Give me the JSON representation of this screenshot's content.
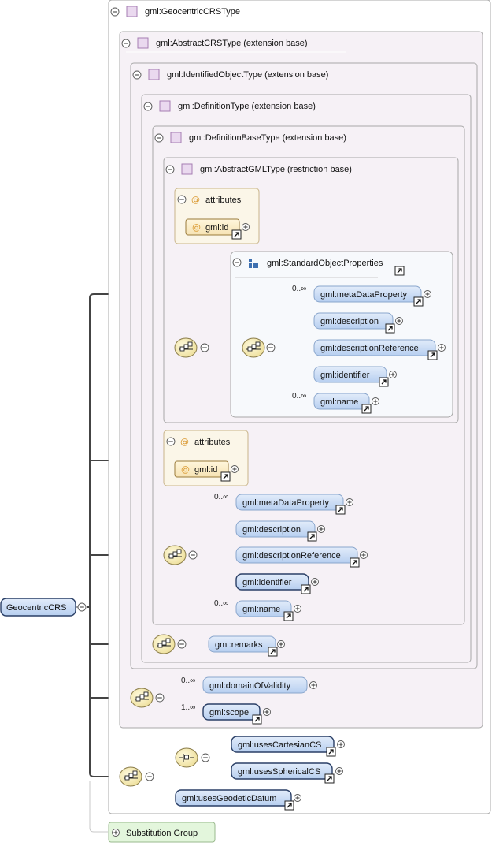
{
  "root": {
    "name": "GeocentricCRS"
  },
  "types": {
    "geocentric": "gml:GeocentricCRSType",
    "abstract_crs": "gml:AbstractCRSType (extension base)",
    "identified_object": "gml:IdentifiedObjectType (extension base)",
    "definition": "gml:DefinitionType (extension base)",
    "definition_base": "gml:DefinitionBaseType (extension base)",
    "abstract_gml": "gml:AbstractGMLType (restriction base)"
  },
  "abstract_gml": {
    "attributes_label": "attributes",
    "attr_id": "gml:id",
    "group_name": "gml:StandardObjectProperties",
    "group_elements": [
      {
        "name": "gml:metaDataProperty",
        "occurrence": "0..∞"
      },
      {
        "name": "gml:description",
        "occurrence": ""
      },
      {
        "name": "gml:descriptionReference",
        "occurrence": ""
      },
      {
        "name": "gml:identifier",
        "occurrence": ""
      },
      {
        "name": "gml:name",
        "occurrence": "0..∞"
      }
    ]
  },
  "definition_base": {
    "attributes_label": "attributes",
    "attr_id": "gml:id",
    "elements": [
      {
        "name": "gml:metaDataProperty",
        "occurrence": "0..∞"
      },
      {
        "name": "gml:description",
        "occurrence": ""
      },
      {
        "name": "gml:descriptionReference",
        "occurrence": ""
      },
      {
        "name": "gml:identifier",
        "occurrence": ""
      },
      {
        "name": "gml:name",
        "occurrence": "0..∞"
      }
    ]
  },
  "identified_object": {
    "remarks": "gml:remarks"
  },
  "abstract_crs": {
    "domain_of_validity": {
      "name": "gml:domainOfValidity",
      "occurrence": "0..∞"
    },
    "scope": {
      "name": "gml:scope",
      "occurrence": "1..∞"
    }
  },
  "geocentric": {
    "uses_cartesian_cs": "gml:usesCartesianCS",
    "uses_spherical_cs": "gml:usesSphericalCS",
    "uses_geodetic_datum": "gml:usesGeodeticDatum"
  },
  "substitution_group": "Substitution Group",
  "colors": {
    "pill_fill": "#c6dbf5",
    "pill_stroke": "#5c7fb0",
    "container_fill": "#f6f1f6",
    "container_stroke": "#a8a8a8",
    "attributes_fill": "#fbf6e8",
    "attributes_stroke": "#c8b48a",
    "compositor_fill": "#f7f0c0",
    "subst_fill": "#e3f6dc"
  }
}
